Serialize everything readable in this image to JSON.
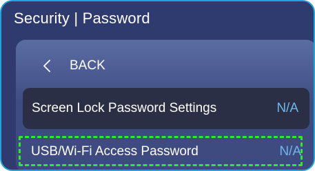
{
  "header": {
    "title": "Security | Password"
  },
  "nav": {
    "back_label": "BACK",
    "back_icon": "chevron-left-icon"
  },
  "settings": {
    "items": [
      {
        "label": "Screen Lock Password Settings",
        "value": "N/A",
        "selected": true
      },
      {
        "label": "USB/Wi-Fi Access Password",
        "value": "N/A",
        "selected": false,
        "highlighted": true
      }
    ]
  },
  "colors": {
    "frame_bg": "#2f3a6f",
    "frame_border": "#1fa6d8",
    "panel_bg": "#4a5a91",
    "selected_row_bg": "#2a2f45",
    "value_text": "#6fb7ea",
    "highlight_outline": "#33e62e"
  }
}
